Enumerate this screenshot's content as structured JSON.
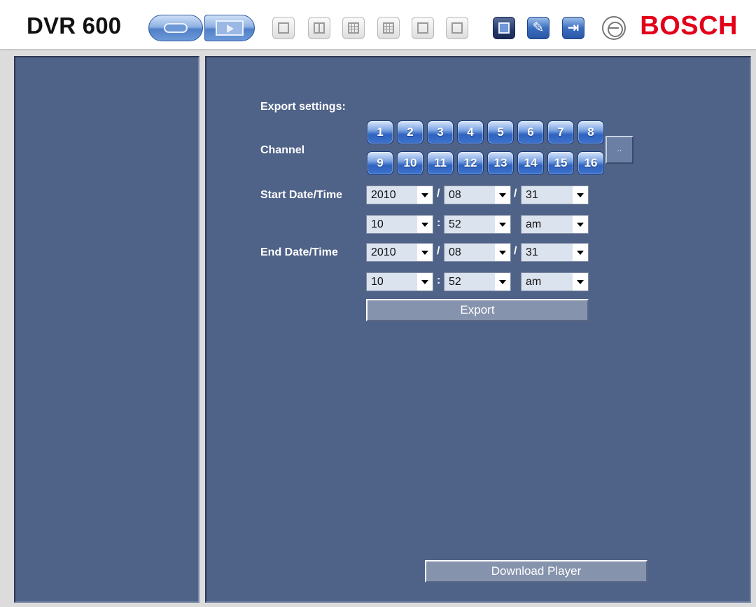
{
  "header": {
    "app_title": "DVR 600",
    "brand": "BOSCH",
    "brand_color": "#e2001a",
    "mode_buttons": [
      {
        "name": "live-view",
        "icon": "live-icon"
      },
      {
        "name": "playback",
        "icon": "playback-icon"
      }
    ],
    "toolbar_icons": [
      {
        "name": "single-view-icon",
        "enabled": false
      },
      {
        "name": "quad-view-icon",
        "enabled": false
      },
      {
        "name": "nine-view-icon",
        "enabled": false
      },
      {
        "name": "sixteen-view-icon",
        "enabled": false
      },
      {
        "name": "sequence-icon",
        "enabled": false
      },
      {
        "name": "fullscreen-icon",
        "enabled": false
      },
      {
        "name": "export-icon",
        "enabled": true
      },
      {
        "name": "settings-wrench-icon",
        "enabled": true
      },
      {
        "name": "logout-icon",
        "enabled": true
      }
    ]
  },
  "export": {
    "heading": "Export settings:",
    "channel_label": "Channel",
    "channels_row1": [
      "1",
      "2",
      "3",
      "4",
      "5",
      "6",
      "7",
      "8"
    ],
    "channels_row2": [
      "9",
      "10",
      "11",
      "12",
      "13",
      "14",
      "15",
      "16"
    ],
    "more_label": "..",
    "start_label": "Start Date/Time",
    "start": {
      "year": "2010",
      "month": "08",
      "day": "31",
      "hour": "10",
      "minute": "52",
      "ampm": "am"
    },
    "end_label": "End Date/Time",
    "end": {
      "year": "2010",
      "month": "08",
      "day": "31",
      "hour": "10",
      "minute": "52",
      "ampm": "am"
    },
    "date_sep": "/",
    "time_sep": ":",
    "export_button": "Export",
    "download_button": "Download Player"
  },
  "colors": {
    "panel_bg": "#4f6287",
    "channel_button": "#2f63bf"
  }
}
